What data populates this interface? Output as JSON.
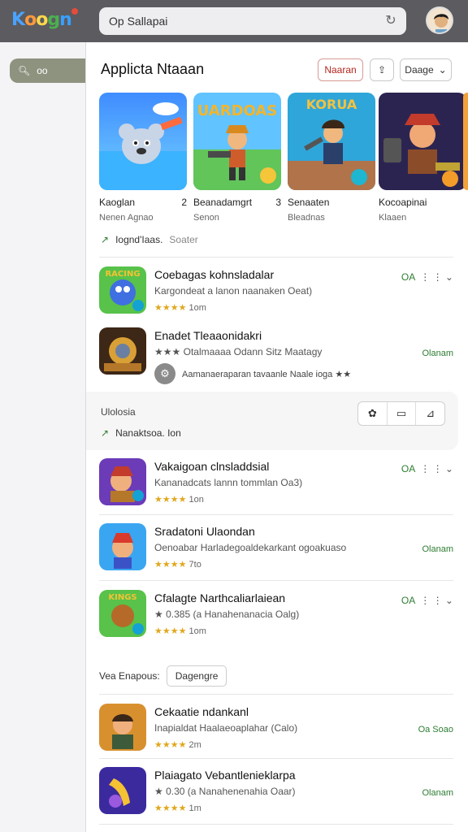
{
  "topbar": {
    "logo": "Koogn",
    "search_value": "Op Sallapai",
    "reload_icon": "reload-icon",
    "avatar": "avatar-icon"
  },
  "sidebar": {
    "pill_label": "oo",
    "pill_icon": "search-icon"
  },
  "header": {
    "title": "Applicta Ntaaan",
    "btn_primary": "Naaran",
    "btn_share_icon": "share-icon",
    "btn_dropdown": "Daage",
    "colors": {
      "accent_red": "#b3261e",
      "green": "#2e7d32",
      "star": "#e0a81e"
    }
  },
  "carousel": [
    {
      "title": "Kaoglan",
      "badge": "2",
      "subtitle": "Nenen Agnao"
    },
    {
      "title": "Beanadamgrt",
      "badge": "3",
      "subtitle": "Senon"
    },
    {
      "title": "Senaaten",
      "badge": "",
      "subtitle": "Bleadnas"
    },
    {
      "title": "Kocoapinai",
      "badge": "",
      "subtitle": "Klaaen"
    }
  ],
  "tagline": {
    "label": "Iognd'Iaas.",
    "muted": "Soater"
  },
  "apps_top": [
    {
      "name": "Coebagas kohnsladalar",
      "desc": "Kargondeat a lanon naanaken Oeat)",
      "stars": "★★★★",
      "meta": "1om",
      "right": "OA",
      "right_extra": "⋮ ⋮ ⌄"
    },
    {
      "name": "Enadet Tleaaonidakri",
      "desc": "★★★ Otalmaaaa Odann Sitz Maatagy",
      "chip_text": "Aamanaeraparan tavaanle Naale ioga ★★",
      "right": "Olanam"
    }
  ],
  "section": {
    "label": "Ulolosia",
    "sub": "Nanaktsoa. Ion",
    "tools": [
      "✿",
      "▭",
      "⊿"
    ]
  },
  "apps_mid": [
    {
      "name": "Vakaigoan clnsladdsial",
      "desc": "Kananadcats lannn tommlan Oa3)",
      "stars": "★★★★",
      "meta": "1on",
      "right": "OA",
      "right_extra": "⋮ ⋮ ⌄"
    },
    {
      "name": "Sradatoni Ulaondan",
      "desc": "Oenoabar Harladegoaldekarkant ogoakuaso",
      "stars": "★★★★",
      "meta": "7to",
      "right": "Olanam"
    },
    {
      "name": "Cfalagte Narthcaliarlaiean",
      "desc": "★ 0.385 (a Hanahenanacia Oalg)",
      "stars": "★★★★",
      "meta": "1om",
      "right": "OA",
      "right_extra": "⋮ ⋮ ⌄"
    }
  ],
  "group": {
    "label": "Vea Enapous:",
    "chip": "Dagengre"
  },
  "apps_bottom": [
    {
      "name": "Cekaatie ndankanl",
      "desc": "Inapialdat Haalaeoaplahar (Calo)",
      "stars": "★★★★",
      "meta": "2m",
      "right": "Oa Soao"
    },
    {
      "name": "Plaiagato Vebantlenieklarpa",
      "desc": "★ 0.30 (a Nanahenenahia Oaar)",
      "stars": "★★★★",
      "meta": "1m",
      "right": "Olanam"
    }
  ]
}
